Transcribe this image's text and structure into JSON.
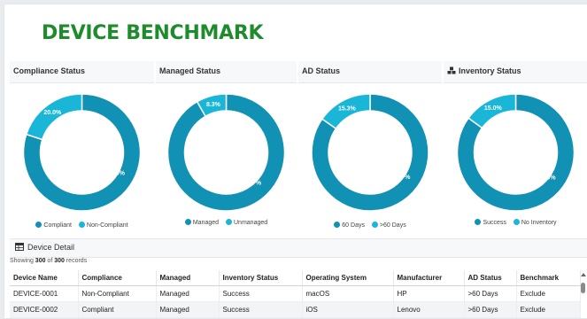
{
  "header": {
    "title": "DEVICE BENCHMARK"
  },
  "colors": {
    "primary": "#1191b3",
    "secondary": "#1ab6d8",
    "title_green": "#1e8c2c"
  },
  "panels": [
    {
      "title": "Compliance Status",
      "icon": "",
      "chart_data": {
        "type": "pie",
        "title": "Compliance Status",
        "categories": [
          "Compliant",
          "Non-Compliant"
        ],
        "values": [
          80.0,
          20.0
        ],
        "labels": [
          "80.0%",
          "20.0%"
        ],
        "legend": "bottom"
      }
    },
    {
      "title": "Managed Status",
      "icon": "",
      "chart_data": {
        "type": "pie",
        "title": "Managed Status",
        "categories": [
          "Managed",
          "Unmanaged"
        ],
        "values": [
          91.7,
          8.3
        ],
        "labels": [
          "91.7%",
          "8.3%"
        ],
        "legend": "bottom"
      }
    },
    {
      "title": "AD Status",
      "icon": "",
      "chart_data": {
        "type": "pie",
        "title": "AD Status",
        "categories": [
          "60 Days",
          ">60 Days"
        ],
        "values": [
          84.7,
          15.3
        ],
        "labels": [
          "84.7%",
          "15.3%"
        ],
        "legend": "bottom"
      }
    },
    {
      "title": "Inventory Status",
      "icon": "inventory-icon",
      "chart_data": {
        "type": "pie",
        "title": "Inventory Status",
        "categories": [
          "Success",
          "No Inventory"
        ],
        "values": [
          85.0,
          15.0
        ],
        "labels": [
          "85.0%",
          "15.0%"
        ],
        "legend": "bottom"
      }
    }
  ],
  "detail": {
    "title": "Device Detail",
    "icon": "table-icon",
    "showing_prefix": "Showing ",
    "showing_count": "300",
    "showing_of": " of ",
    "showing_total": "300",
    "showing_suffix": " records",
    "columns": [
      "Device Name",
      "Compliance",
      "Managed",
      "Inventory Status",
      "Operating System",
      "Manufacturer",
      "AD Status",
      "Benchmark"
    ],
    "rows": [
      [
        "DEVICE-0001",
        "Non-Compliant",
        "Managed",
        "Success",
        "macOS",
        "HP",
        ">60 Days",
        "Exclude"
      ],
      [
        "DEVICE-0002",
        "Compliant",
        "Managed",
        "Success",
        "iOS",
        "Lenovo",
        ">60 Days",
        "Exclude"
      ]
    ]
  }
}
